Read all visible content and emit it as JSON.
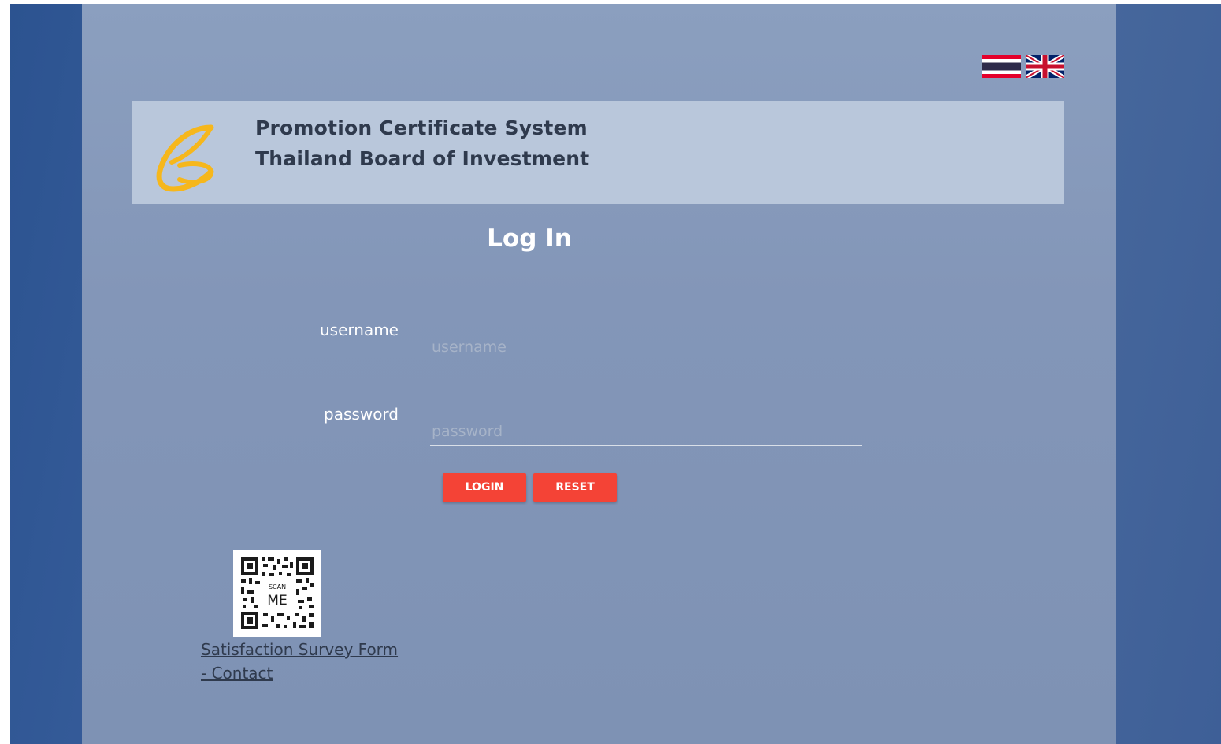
{
  "header": {
    "title_line1": "Promotion Certificate System",
    "title_line2": "Thailand Board of Investment",
    "logo_icon": "boi-butterfly-logo"
  },
  "language_switch": {
    "thai_flag_icon": "thai-flag-icon",
    "uk_flag_icon": "uk-flag-icon"
  },
  "login": {
    "title": "Log In",
    "username_label": "username",
    "username_placeholder": "username",
    "username_value": "",
    "password_label": "password",
    "password_placeholder": "password",
    "password_value": "",
    "login_button": "LOGIN",
    "reset_button": "RESET"
  },
  "footer": {
    "qr_icon": "qr-code-scan-me",
    "qr_caption_small": "SCAN",
    "qr_caption_large": "ME",
    "survey_link": "Satisfaction Survey Form",
    "contact_link": "- Contact"
  },
  "colors": {
    "outer_bg": "#2c5390",
    "panel_bg": "#8b9fbf",
    "header_band": "#b9c7db",
    "button_red": "#f44336",
    "logo_yellow": "#f6b71c"
  }
}
